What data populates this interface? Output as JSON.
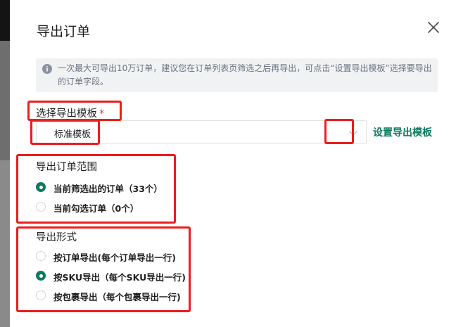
{
  "dialog": {
    "title": "导出订单",
    "close_icon": "close-icon"
  },
  "notice": {
    "icon": "info-icon",
    "text": "一次最大可导出10万订单，建议您在订单列表页筛选之后再导出，可点击“设置导出模板”选择要导出的订单字段。"
  },
  "template": {
    "label": "选择导出模板",
    "required_mark": "*",
    "selected": "标准模板",
    "chevron_icon": "chevron-down-icon",
    "settings_link": "设置导出模板"
  },
  "range": {
    "label": "导出订单范围",
    "options": [
      {
        "label": "当前筛选出的订单（33个）",
        "checked": true
      },
      {
        "label": "当前勾选订单（0个）",
        "checked": false
      }
    ]
  },
  "format": {
    "label": "导出形式",
    "options": [
      {
        "label": "按订单导出(每个订单导出一行)",
        "checked": false
      },
      {
        "label": "按SKU导出（每个SKU导出一行)",
        "checked": true
      },
      {
        "label": "按包裹导出（每个包裹导出一行)",
        "checked": false
      }
    ]
  },
  "colors": {
    "accent": "#0e7a5f",
    "highlight": "#ec1d1d",
    "required": "#e53935",
    "notice_bg": "#f0f2f4"
  }
}
